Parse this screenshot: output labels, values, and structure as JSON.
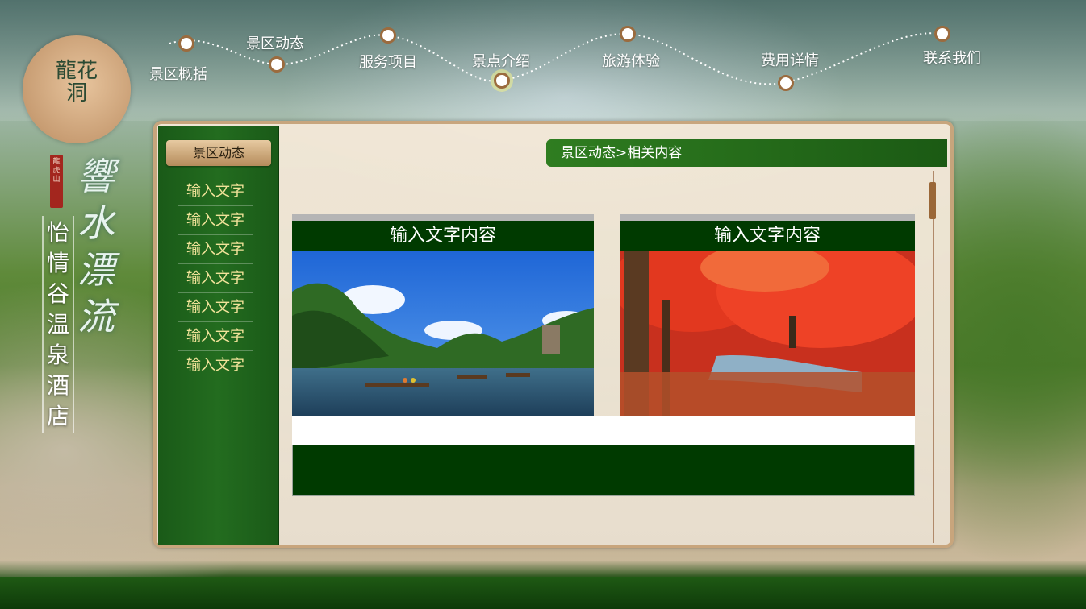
{
  "brand": {
    "logo_text": "龍花洞",
    "seal_text": "龍虎山",
    "calligraphy": "響水漂流",
    "hotel_name": "怡情谷温泉酒店"
  },
  "nav": {
    "items": [
      {
        "label": "景区概括"
      },
      {
        "label": "景区动态"
      },
      {
        "label": "服务项目"
      },
      {
        "label": "景点介绍"
      },
      {
        "label": "旅游体验"
      },
      {
        "label": "费用详情"
      },
      {
        "label": "联系我们"
      }
    ]
  },
  "sidebar": {
    "heading": "景区动态",
    "items": [
      "输入文字",
      "输入文字",
      "输入文字",
      "输入文字",
      "输入文字",
      "输入文字",
      "输入文字"
    ]
  },
  "breadcrumb": "景区动态>相关内容",
  "cards": [
    {
      "title": "输入文字内容",
      "image": "river-rafting-photo"
    },
    {
      "title": "输入文字内容",
      "image": "red-maple-forest-photo"
    }
  ],
  "colors": {
    "sidebar_green": "#236c1f",
    "title_green": "#003a00",
    "accent_brown": "#9b6b3e",
    "menu_text": "#f2e39a"
  }
}
